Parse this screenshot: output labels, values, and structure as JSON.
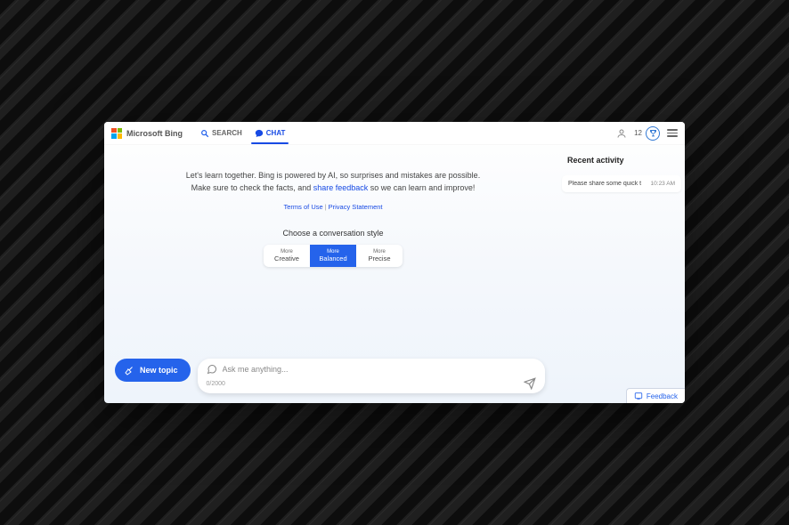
{
  "brand": "Microsoft Bing",
  "nav": {
    "search": "SEARCH",
    "chat": "CHAT"
  },
  "rewards_points": "12",
  "intro": {
    "line1a": "Let's learn together. Bing is powered by AI, so surprises and mistakes are possible.",
    "line2a": "Make sure to check the facts, and ",
    "feedback_link": "share feedback",
    "line2b": " so we can learn and improve!"
  },
  "legal": {
    "terms": "Terms of Use",
    "privacy": "Privacy Statement"
  },
  "style_picker": {
    "title": "Choose a conversation style",
    "more": "More",
    "creative": "Creative",
    "balanced": "Balanced",
    "precise": "Precise"
  },
  "sidebar": {
    "title": "Recent activity",
    "items": [
      {
        "label": "Please share some quick t",
        "time": "10:23 AM"
      }
    ]
  },
  "composer": {
    "new_topic": "New topic",
    "placeholder": "Ask me anything...",
    "counter": "0/2000"
  },
  "feedback_tab": "Feedback"
}
